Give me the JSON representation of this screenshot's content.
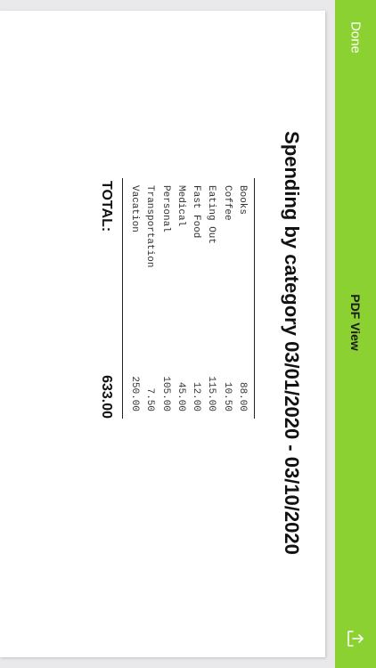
{
  "navbar": {
    "title": "PDF View",
    "done_label": "Done",
    "share_icon": "share-icon",
    "color": "#8bd131"
  },
  "report": {
    "title": "Spending by category 03/01/2020 - 03/10/2020",
    "rows": [
      {
        "category": "Books",
        "amount": "88.00"
      },
      {
        "category": "Coffee",
        "amount": "10.50"
      },
      {
        "category": "Eating Out",
        "amount": "115.00"
      },
      {
        "category": "Fast Food",
        "amount": "12.00"
      },
      {
        "category": "Medical",
        "amount": "45.00"
      },
      {
        "category": "Personal",
        "amount": "105.00"
      },
      {
        "category": "Transportation",
        "amount": "7.50"
      },
      {
        "category": "Vacation",
        "amount": "250.00"
      }
    ],
    "total_label": "TOTAL:",
    "total_value": "633.00"
  }
}
